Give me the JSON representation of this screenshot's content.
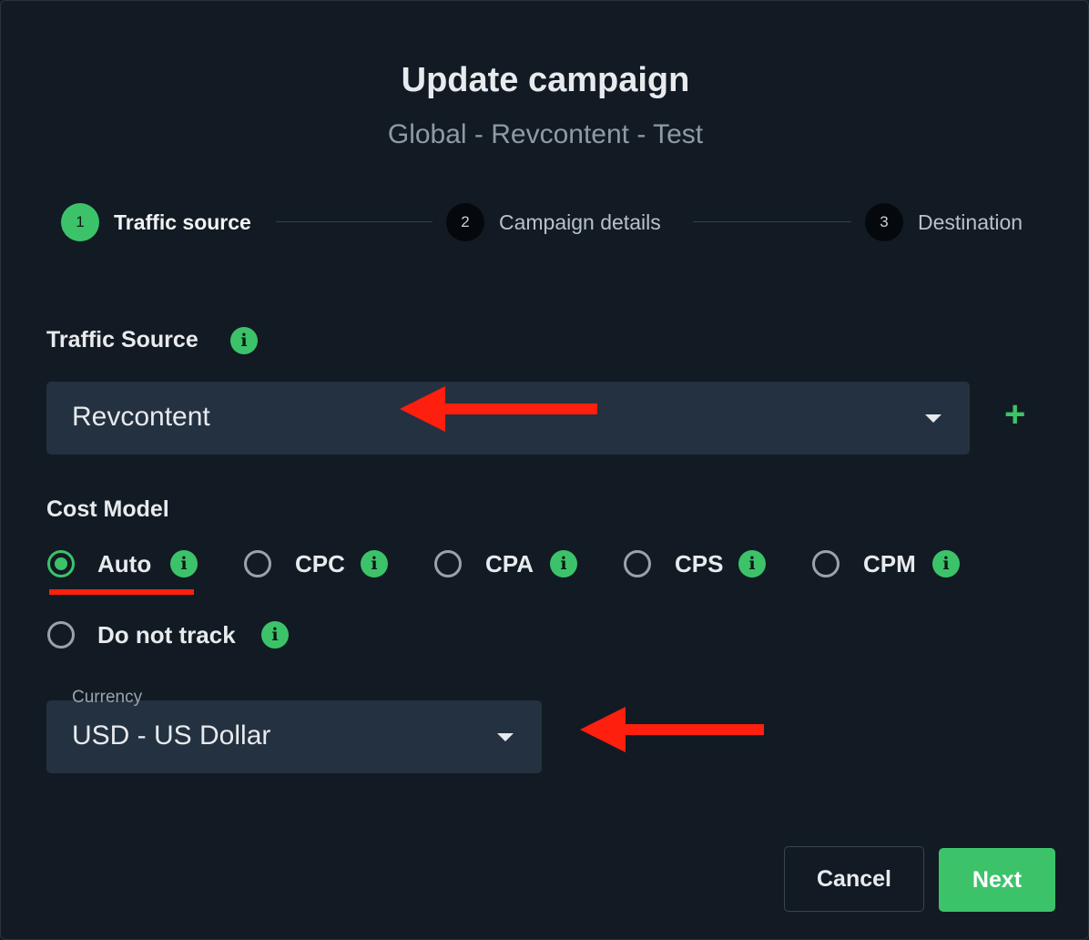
{
  "modal": {
    "title": "Update campaign",
    "subtitle": "Global - Revcontent - Test"
  },
  "stepper": {
    "steps": [
      {
        "number": "1",
        "label": "Traffic source",
        "state": "active"
      },
      {
        "number": "2",
        "label": "Campaign details",
        "state": "pending"
      },
      {
        "number": "3",
        "label": "Destination",
        "state": "pending"
      }
    ]
  },
  "traffic_source": {
    "label": "Traffic Source",
    "value": "Revcontent",
    "info_icon": "info-icon",
    "add_icon": "plus-icon"
  },
  "cost_model": {
    "label": "Cost Model",
    "selected": "Auto",
    "options": [
      "Auto",
      "CPC",
      "CPA",
      "CPS",
      "CPM",
      "Do not track"
    ]
  },
  "currency": {
    "label": "Currency",
    "value": "USD - US Dollar"
  },
  "footer": {
    "cancel_label": "Cancel",
    "next_label": "Next"
  },
  "colors": {
    "background": "#121b23",
    "accent": "#3cc36a",
    "field": "#243140",
    "annotation": "#ff1f0f"
  }
}
